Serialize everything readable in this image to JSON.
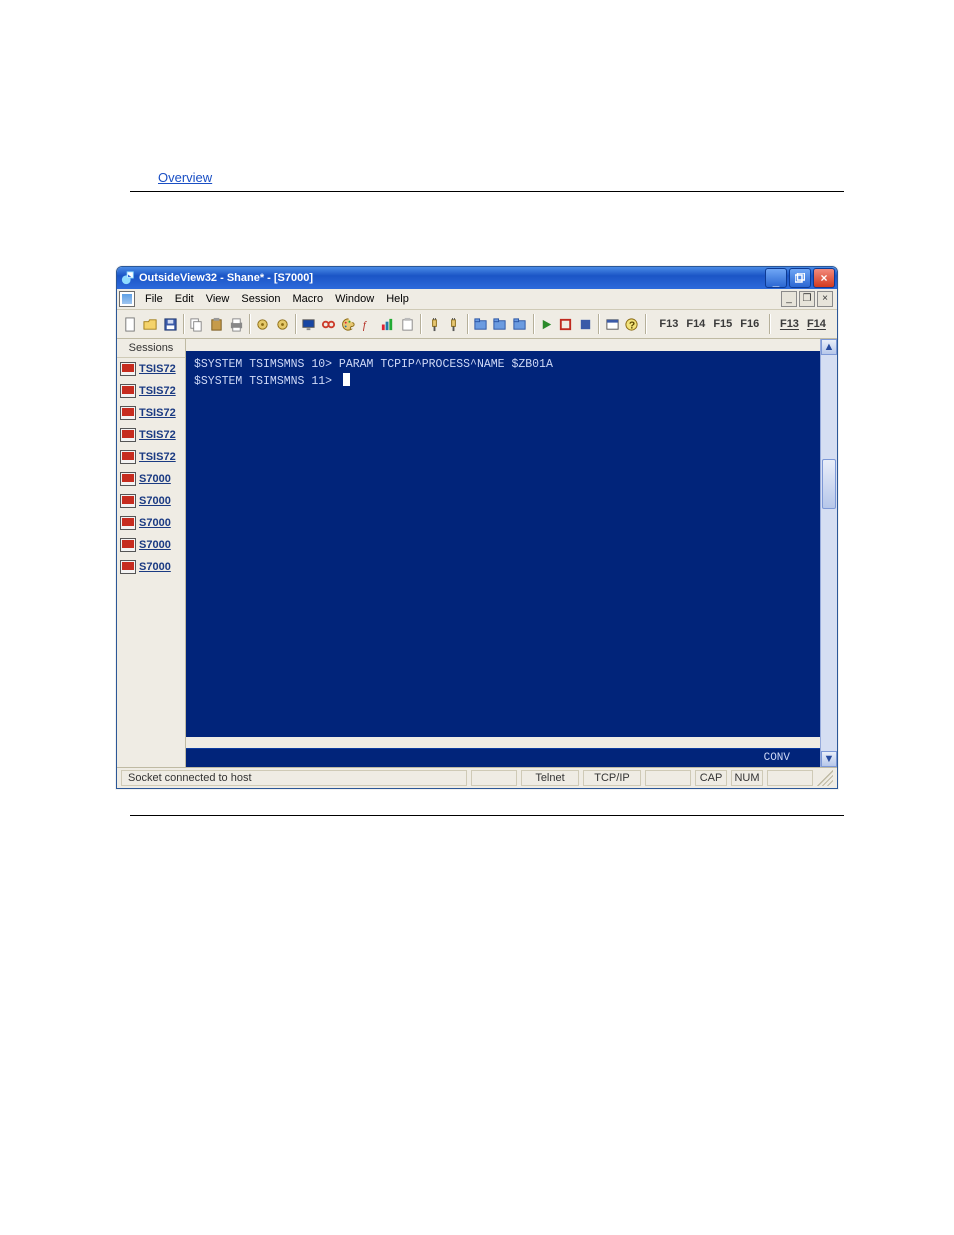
{
  "doc_link": "Overview",
  "window": {
    "title": "OutsideView32 - Shane* - [S7000]"
  },
  "menu": {
    "items": [
      "File",
      "Edit",
      "View",
      "Session",
      "Macro",
      "Window",
      "Help"
    ]
  },
  "toolbar": {
    "groups": [
      [
        {
          "name": "new-icon",
          "glyph": "new"
        },
        {
          "name": "open-icon",
          "glyph": "open"
        },
        {
          "name": "save-icon",
          "glyph": "save"
        }
      ],
      [
        {
          "name": "copy-icon",
          "glyph": "copy"
        },
        {
          "name": "paste-icon",
          "glyph": "paste"
        },
        {
          "name": "print-icon",
          "glyph": "print"
        }
      ],
      [
        {
          "name": "tool-a-icon",
          "glyph": "tool"
        },
        {
          "name": "tool-b-icon",
          "glyph": "tool"
        }
      ],
      [
        {
          "name": "monitor-icon",
          "glyph": "monitor"
        },
        {
          "name": "connect-icon",
          "glyph": "link"
        },
        {
          "name": "palette-icon",
          "glyph": "palette"
        },
        {
          "name": "function-icon",
          "glyph": "fx"
        },
        {
          "name": "chart-icon",
          "glyph": "chart"
        },
        {
          "name": "clipboard-icon",
          "glyph": "clip"
        }
      ],
      [
        {
          "name": "plug-a-icon",
          "glyph": "plug"
        },
        {
          "name": "plug-b-icon",
          "glyph": "plug"
        }
      ],
      [
        {
          "name": "tab-a-icon",
          "glyph": "tab"
        },
        {
          "name": "tab-b-icon",
          "glyph": "tab"
        },
        {
          "name": "tab-c-icon",
          "glyph": "tab"
        }
      ],
      [
        {
          "name": "run-icon",
          "glyph": "play"
        },
        {
          "name": "box-icon",
          "glyph": "box"
        },
        {
          "name": "halt-icon",
          "glyph": "stop"
        }
      ],
      [
        {
          "name": "win-icon",
          "glyph": "window"
        },
        {
          "name": "help-icon",
          "glyph": "help"
        }
      ]
    ],
    "fkeys_left": [
      "F13",
      "F14",
      "F15",
      "F16"
    ],
    "fkeys_right": [
      "F13",
      "F14"
    ]
  },
  "sidebar": {
    "title": "Sessions",
    "items": [
      {
        "label": "TSIS72"
      },
      {
        "label": "TSIS72"
      },
      {
        "label": "TSIS72"
      },
      {
        "label": "TSIS72"
      },
      {
        "label": "TSIS72"
      },
      {
        "label": "S7000"
      },
      {
        "label": "S7000"
      },
      {
        "label": "S7000"
      },
      {
        "label": "S7000"
      },
      {
        "label": "S7000"
      }
    ]
  },
  "terminal": {
    "lines": [
      "$SYSTEM TSIMSMNS 10> PARAM TCPIP^PROCESS^NAME $ZB01A",
      "$SYSTEM TSIMSMNS 11> "
    ],
    "footer": "CONV"
  },
  "statusbar": {
    "message": "Socket connected to host",
    "proto1": "Telnet",
    "proto2": "TCP/IP",
    "cap": "CAP",
    "num": "NUM"
  }
}
